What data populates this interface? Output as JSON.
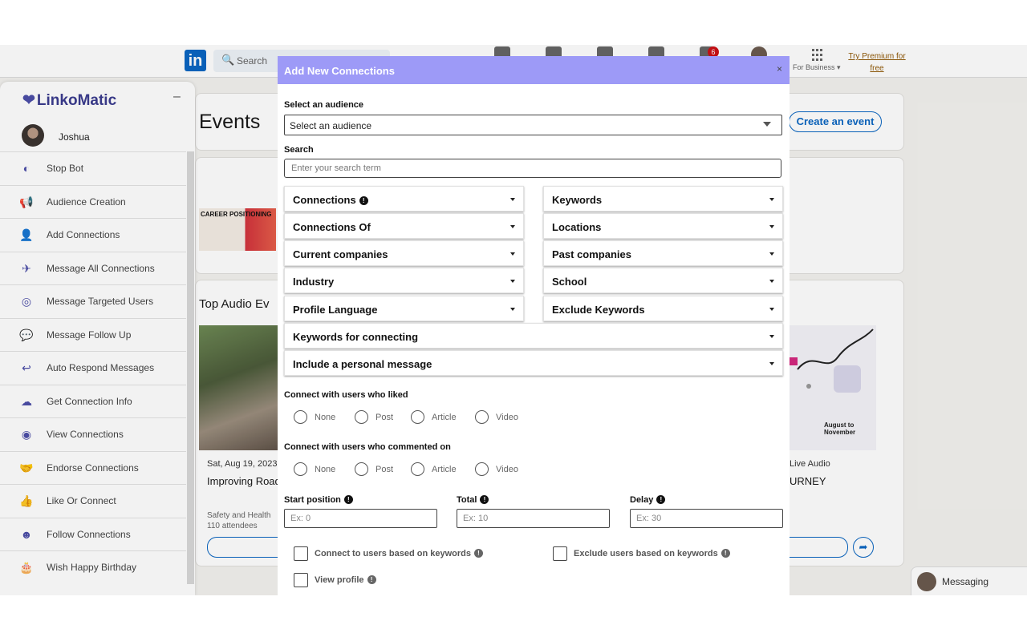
{
  "linkedin": {
    "logo": "in",
    "search_placeholder": "Search",
    "notification_count": "6",
    "for_business": "For Business",
    "premium": "Try Premium for free"
  },
  "events": {
    "title": "Events",
    "create_button": "Create an event",
    "career_img_text": "CAREER POSITIONING",
    "top_audio_title": "Top Audio Ev",
    "event1": {
      "date": "Sat, Aug 19, 2023",
      "title": "Improving Road",
      "org": "Safety and Health",
      "attendees": "110 attendees"
    },
    "event2": {
      "type": "Live Audio",
      "title": "URNEY",
      "poster_text": "August to November"
    }
  },
  "messaging": {
    "label": "Messaging"
  },
  "sidebar": {
    "brand": "LinkoMatic",
    "minimize": "–",
    "user_name": "Joshua",
    "items": [
      {
        "label": "Stop Bot",
        "icon": "toggle-icon",
        "glyph": "◐"
      },
      {
        "label": "Audience Creation",
        "icon": "megaphone-icon",
        "glyph": "📢"
      },
      {
        "label": "Add Connections",
        "icon": "user-plus-icon",
        "glyph": "👤"
      },
      {
        "label": "Message All Connections",
        "icon": "paper-plane-icon",
        "glyph": "✈"
      },
      {
        "label": "Message Targeted Users",
        "icon": "target-icon",
        "glyph": "◎"
      },
      {
        "label": "Message Follow Up",
        "icon": "chat-bubbles-icon",
        "glyph": "💬"
      },
      {
        "label": "Auto Respond Messages",
        "icon": "reply-icon",
        "glyph": "↩"
      },
      {
        "label": "Get Connection Info",
        "icon": "cloud-download-icon",
        "glyph": "☁"
      },
      {
        "label": "View Connections",
        "icon": "eye-icon",
        "glyph": "◉"
      },
      {
        "label": "Endorse Connections",
        "icon": "handshake-icon",
        "glyph": "🤝"
      },
      {
        "label": "Like Or Connect",
        "icon": "thumbs-up-icon",
        "glyph": "👍"
      },
      {
        "label": "Follow Connections",
        "icon": "user-circle-icon",
        "glyph": "☻"
      },
      {
        "label": "Wish Happy Birthday",
        "icon": "birthday-cake-icon",
        "glyph": "🎂"
      }
    ]
  },
  "modal": {
    "title": "Add New Connections",
    "close": "×",
    "audience_label": "Select an audience",
    "audience_value": "Select an audience",
    "search_label": "Search",
    "search_placeholder": "Enter your search term",
    "filters_left": [
      "Connections",
      "Connections Of",
      "Current companies",
      "Industry",
      "Profile Language"
    ],
    "filters_right": [
      "Keywords",
      "Locations",
      "Past companies",
      "School",
      "Exclude Keywords"
    ],
    "filter_full": [
      "Keywords for connecting",
      "Include a personal message"
    ],
    "liked_label": "Connect with users who liked",
    "commented_label": "Connect with users who commented on",
    "radio_options": [
      "None",
      "Post",
      "Article",
      "Video"
    ],
    "start_label": "Start position",
    "start_placeholder": "Ex: 0",
    "total_label": "Total",
    "total_placeholder": "Ex: 10",
    "delay_label": "Delay",
    "delay_placeholder": "Ex: 30",
    "check_keywords": "Connect to users based on keywords",
    "check_exclude": "Exclude users based on keywords",
    "check_view_profile": "View profile",
    "info_glyph": "!"
  }
}
